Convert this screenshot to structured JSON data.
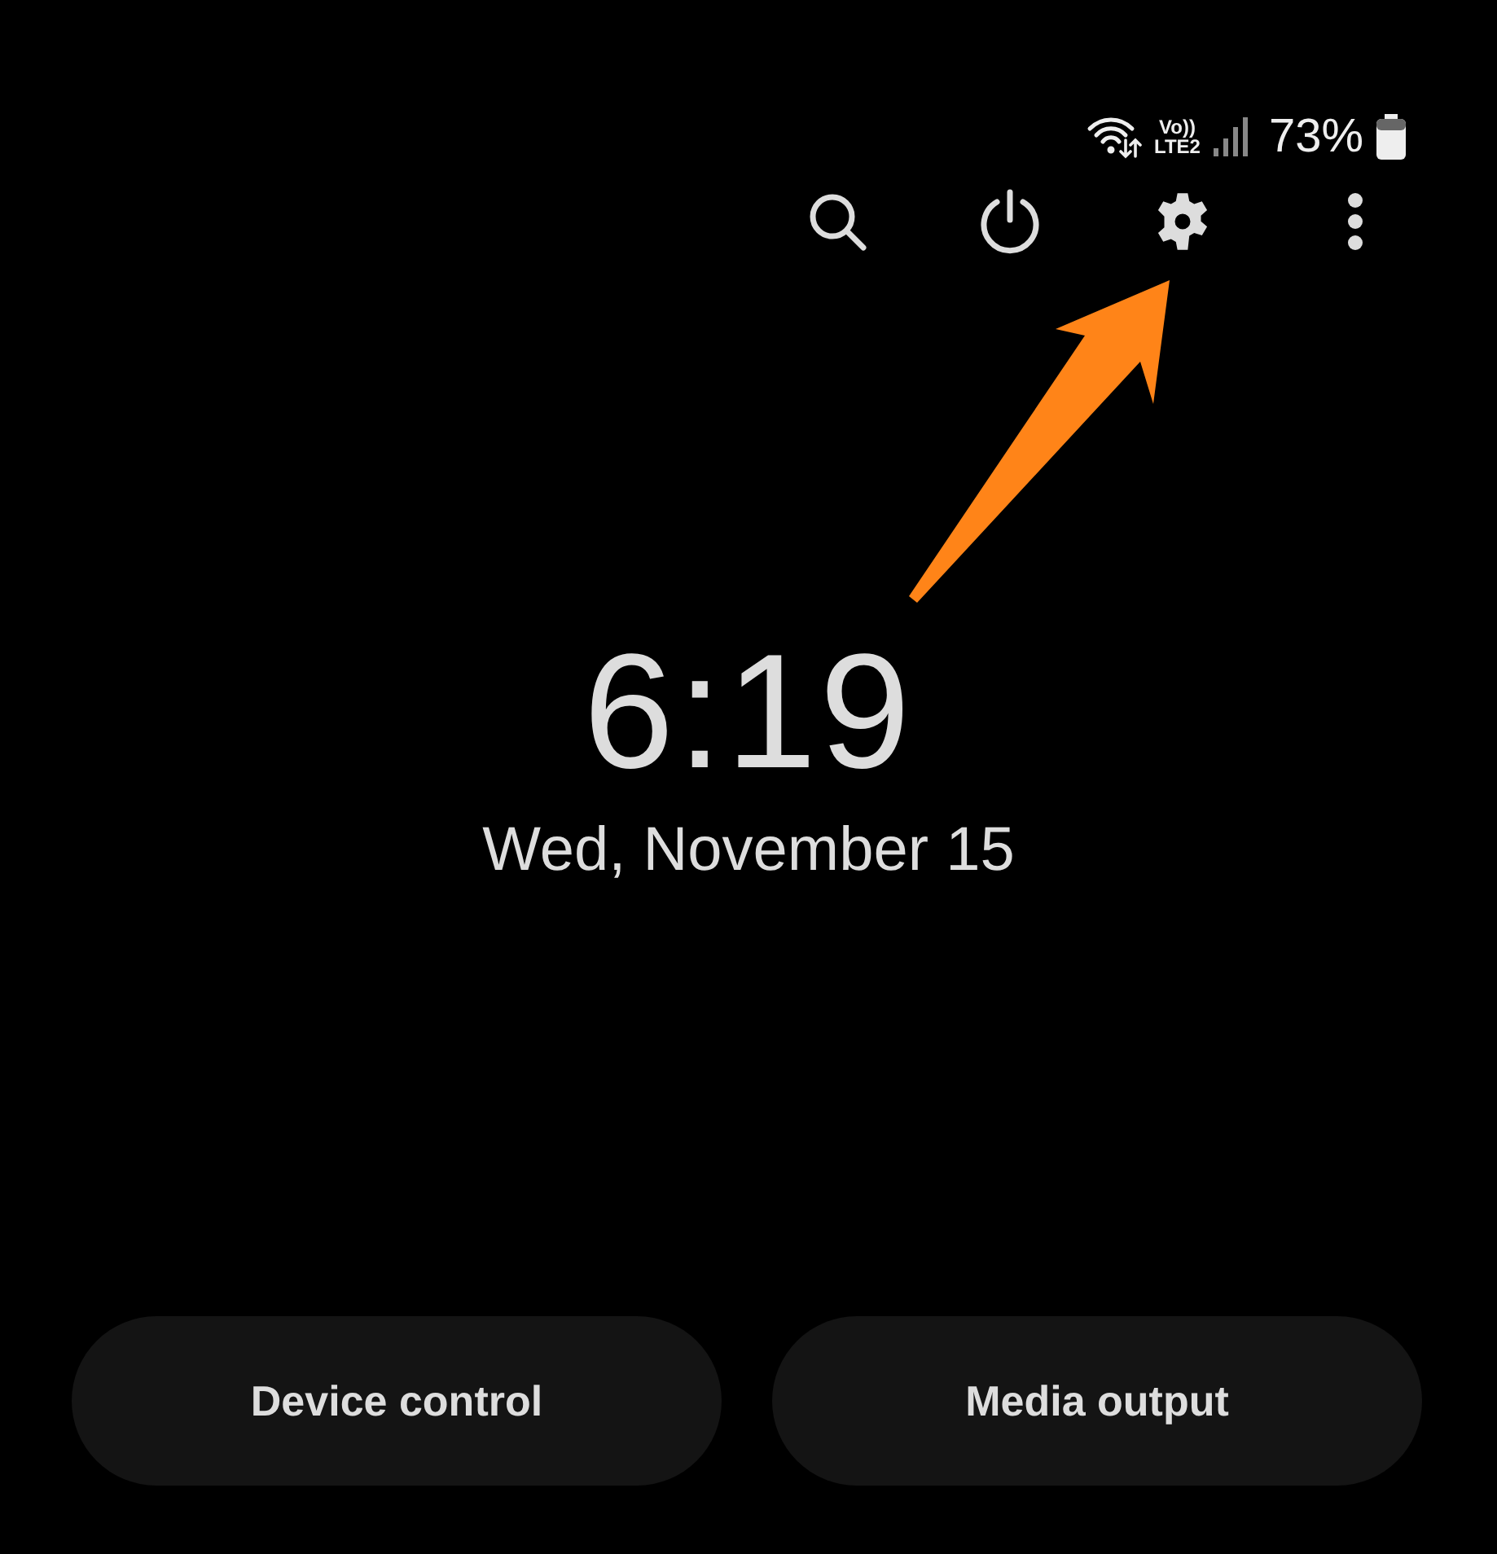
{
  "status_bar": {
    "network_top": "Vo))",
    "network_bottom": "LTE2",
    "battery": "73%"
  },
  "toolbar": [
    {
      "kind": "search"
    },
    {
      "kind": "power"
    },
    {
      "kind": "settings"
    },
    {
      "kind": "more"
    }
  ],
  "clock": {
    "time": "6:19",
    "date": "Wed, November 15"
  },
  "buttons": [
    {
      "label": "Device control"
    },
    {
      "label": "Media output"
    }
  ]
}
